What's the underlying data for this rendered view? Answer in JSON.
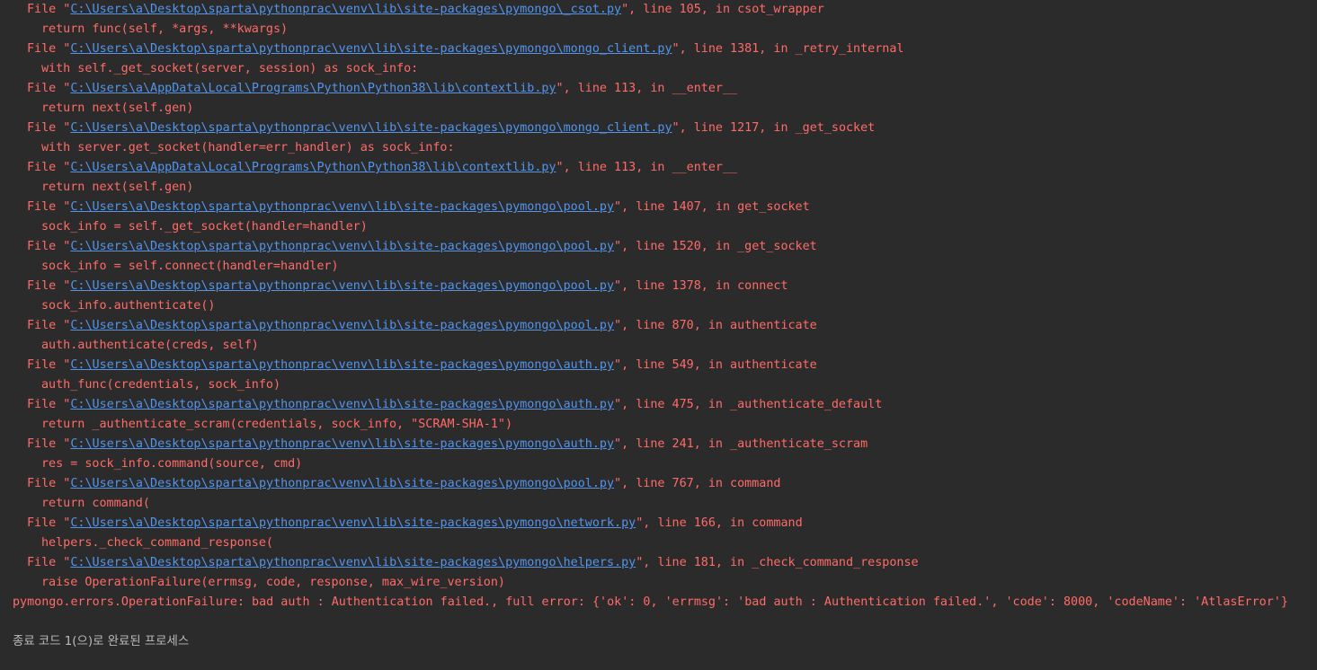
{
  "traceback": [
    {
      "type": "file",
      "path": "C:\\Users\\a\\Desktop\\sparta\\pythonprac\\venv\\lib\\site-packages\\pymongo\\_csot.py",
      "line": "105",
      "func": "csot_wrapper"
    },
    {
      "type": "code",
      "text": "return func(self, *args, **kwargs)"
    },
    {
      "type": "file",
      "path": "C:\\Users\\a\\Desktop\\sparta\\pythonprac\\venv\\lib\\site-packages\\pymongo\\mongo_client.py",
      "line": "1381",
      "func": "_retry_internal"
    },
    {
      "type": "code",
      "text": "with self._get_socket(server, session) as sock_info:"
    },
    {
      "type": "file",
      "path": "C:\\Users\\a\\AppData\\Local\\Programs\\Python\\Python38\\lib\\contextlib.py",
      "line": "113",
      "func": "__enter__"
    },
    {
      "type": "code",
      "text": "return next(self.gen)"
    },
    {
      "type": "file",
      "path": "C:\\Users\\a\\Desktop\\sparta\\pythonprac\\venv\\lib\\site-packages\\pymongo\\mongo_client.py",
      "line": "1217",
      "func": "_get_socket"
    },
    {
      "type": "code",
      "text": "with server.get_socket(handler=err_handler) as sock_info:"
    },
    {
      "type": "file",
      "path": "C:\\Users\\a\\AppData\\Local\\Programs\\Python\\Python38\\lib\\contextlib.py",
      "line": "113",
      "func": "__enter__"
    },
    {
      "type": "code",
      "text": "return next(self.gen)"
    },
    {
      "type": "file",
      "path": "C:\\Users\\a\\Desktop\\sparta\\pythonprac\\venv\\lib\\site-packages\\pymongo\\pool.py",
      "line": "1407",
      "func": "get_socket"
    },
    {
      "type": "code",
      "text": "sock_info = self._get_socket(handler=handler)"
    },
    {
      "type": "file",
      "path": "C:\\Users\\a\\Desktop\\sparta\\pythonprac\\venv\\lib\\site-packages\\pymongo\\pool.py",
      "line": "1520",
      "func": "_get_socket"
    },
    {
      "type": "code",
      "text": "sock_info = self.connect(handler=handler)"
    },
    {
      "type": "file",
      "path": "C:\\Users\\a\\Desktop\\sparta\\pythonprac\\venv\\lib\\site-packages\\pymongo\\pool.py",
      "line": "1378",
      "func": "connect"
    },
    {
      "type": "code",
      "text": "sock_info.authenticate()"
    },
    {
      "type": "file",
      "path": "C:\\Users\\a\\Desktop\\sparta\\pythonprac\\venv\\lib\\site-packages\\pymongo\\pool.py",
      "line": "870",
      "func": "authenticate"
    },
    {
      "type": "code",
      "text": "auth.authenticate(creds, self)"
    },
    {
      "type": "file",
      "path": "C:\\Users\\a\\Desktop\\sparta\\pythonprac\\venv\\lib\\site-packages\\pymongo\\auth.py",
      "line": "549",
      "func": "authenticate"
    },
    {
      "type": "code",
      "text": "auth_func(credentials, sock_info)"
    },
    {
      "type": "file",
      "path": "C:\\Users\\a\\Desktop\\sparta\\pythonprac\\venv\\lib\\site-packages\\pymongo\\auth.py",
      "line": "475",
      "func": "_authenticate_default"
    },
    {
      "type": "code",
      "text": "return _authenticate_scram(credentials, sock_info, \"SCRAM-SHA-1\")"
    },
    {
      "type": "file",
      "path": "C:\\Users\\a\\Desktop\\sparta\\pythonprac\\venv\\lib\\site-packages\\pymongo\\auth.py",
      "line": "241",
      "func": "_authenticate_scram"
    },
    {
      "type": "code",
      "text": "res = sock_info.command(source, cmd)"
    },
    {
      "type": "file",
      "path": "C:\\Users\\a\\Desktop\\sparta\\pythonprac\\venv\\lib\\site-packages\\pymongo\\pool.py",
      "line": "767",
      "func": "command"
    },
    {
      "type": "code",
      "text": "return command("
    },
    {
      "type": "file",
      "path": "C:\\Users\\a\\Desktop\\sparta\\pythonprac\\venv\\lib\\site-packages\\pymongo\\network.py",
      "line": "166",
      "func": "command"
    },
    {
      "type": "code",
      "text": "helpers._check_command_response("
    },
    {
      "type": "file",
      "path": "C:\\Users\\a\\Desktop\\sparta\\pythonprac\\venv\\lib\\site-packages\\pymongo\\helpers.py",
      "line": "181",
      "func": "_check_command_response"
    },
    {
      "type": "code",
      "text": "raise OperationFailure(errmsg, code, response, max_wire_version)"
    }
  ],
  "error_message": "pymongo.errors.OperationFailure: bad auth : Authentication failed., full error: {'ok': 0, 'errmsg': 'bad auth : Authentication failed.', 'code': 8000, 'codeName': 'AtlasError'}",
  "exit_message": "종료 코드 1(으)로 완료된 프로세스",
  "colors": {
    "background": "#2b2b2b",
    "error_text": "#ff6b68",
    "link": "#5394ec",
    "exit_text": "#bbbbbb"
  }
}
